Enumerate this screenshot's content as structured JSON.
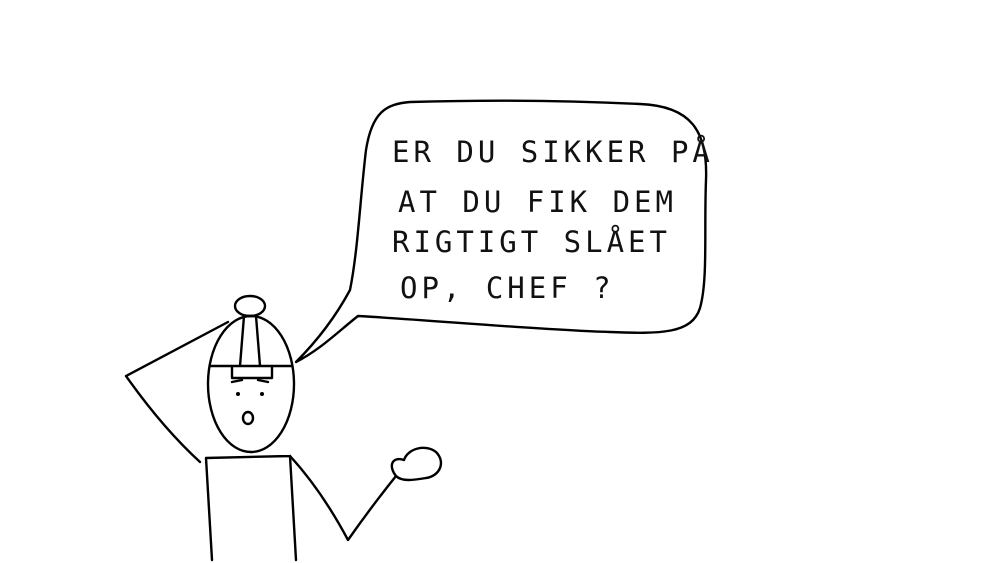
{
  "speech_bubble": {
    "lines": [
      "ER DU SIKKER PÅ",
      "AT DU FIK DEM",
      "RIGTIGT SLÅET",
      "OP, CHEF ?"
    ]
  }
}
